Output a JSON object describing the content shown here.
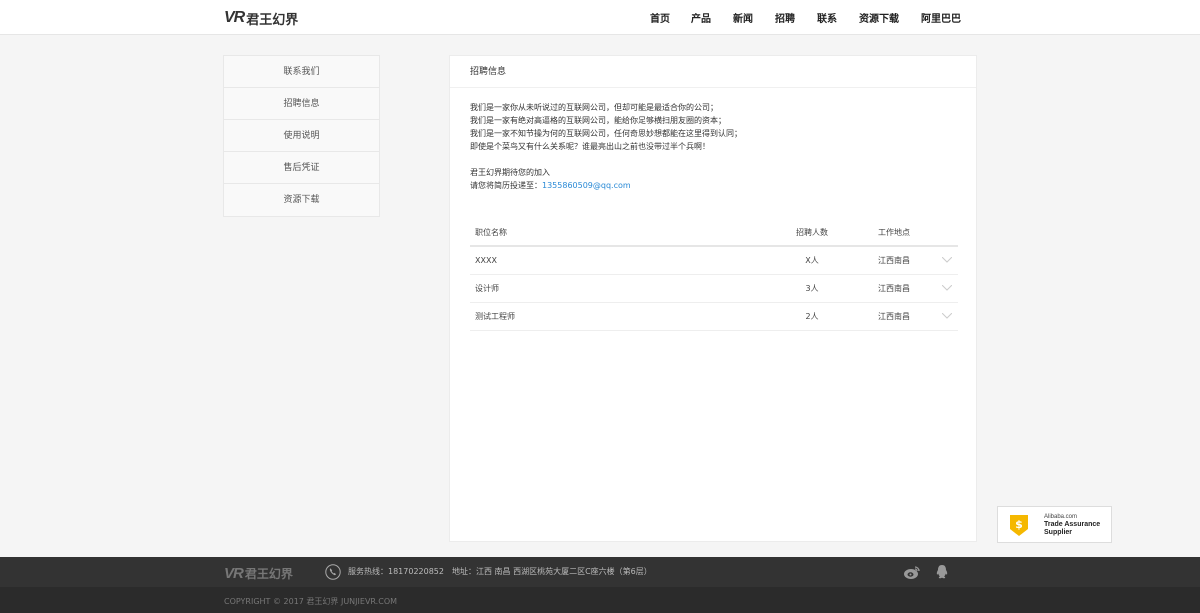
{
  "header": {
    "logo_mark": "VR",
    "logo_text": "君王幻界",
    "nav": [
      "首页",
      "产品",
      "新闻",
      "招聘",
      "联系",
      "资源下载",
      "阿里巴巴"
    ]
  },
  "sidebar": {
    "items": [
      "联系我们",
      "招聘信息",
      "使用说明",
      "售后凭证",
      "资源下载"
    ]
  },
  "main": {
    "title": "招聘信息",
    "intro_lines": [
      "我们是一家你从未听说过的互联网公司，但却可能是最适合你的公司；",
      "我们是一家有绝对高逼格的互联网公司，能给你足够横扫朋友圈的资本；",
      "我们是一家不知节操为何的互联网公司，任何奇思妙想都能在这里得到认同；",
      "即使是个菜鸟又有什么关系呢？谁最亮出山之前也没带过半个兵啊！"
    ],
    "welcome": "君王幻界期待您的加入",
    "resume_prefix": "请您将简历投递至：",
    "email": "1355860509@qq.com",
    "table": {
      "headers": [
        "职位名称",
        "招聘人数",
        "工作地点"
      ],
      "rows": [
        {
          "name": "XXXX",
          "count": "X人",
          "location": "江西南昌"
        },
        {
          "name": "设计师",
          "count": "3人",
          "location": "江西南昌"
        },
        {
          "name": "测试工程师",
          "count": "2人",
          "location": "江西南昌"
        }
      ]
    }
  },
  "trade_badge": {
    "line1": "Alibaba.com",
    "line2": "Trade Assurance",
    "line3": "Supplier"
  },
  "footer": {
    "logo_mark": "VR",
    "logo_text": "君王幻界",
    "hotline": "服务热线：18170220852",
    "address": "地址：江西 南昌 西湖区桃苑大厦二区C座六楼（第6层）",
    "copyright": "COPYRIGHT © 2017 君王幻界 JUNJIEVR.COM"
  }
}
